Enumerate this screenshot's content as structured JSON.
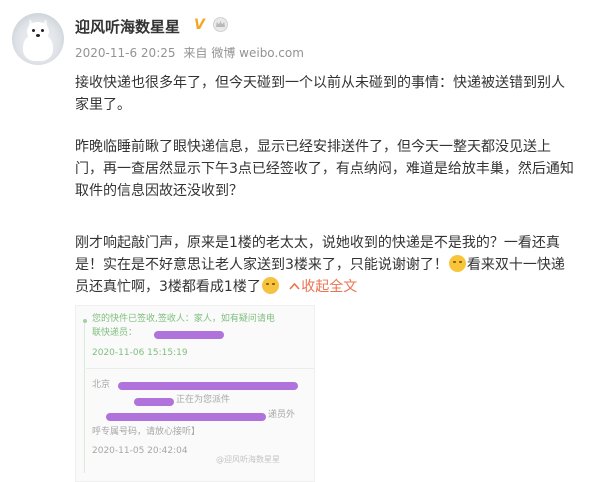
{
  "user": {
    "name": "迎风听海数星星",
    "vip_mark": "V"
  },
  "meta": {
    "datetime": "2020-11-6 20:25",
    "source_prefix": "来自",
    "source": "微博 weibo.com"
  },
  "post": {
    "p1": "接收快递也很多年了，但今天碰到一个以前从未碰到的事情：快递被送错到别人家里了。",
    "p2": "昨晚临睡前瞅了眼快递信息，显示已经安排送件了，但今天一整天都没见送上门，再一查居然显示下午3点已经签收了，有点纳闷，难道是给放丰巢，然后通知取件的信息因故还没收到？",
    "p3_a": "刚才响起敲门声，原来是1楼的老太太，说她收到的快递是不是我的？一看还真是！实在是不好意思让老人家送到3楼来了，只能说谢谢了！",
    "p3_b": "看来双十一快递员还真忙啊，3楼都看成1楼了",
    "collapse": "收起全文",
    "emoji1": "sweat-smile-emoji",
    "emoji2": "laugh-emoji"
  },
  "photo": {
    "entry1_line1": "您的快件已签收,签收人：家人，如有疑问请电",
    "entry1_line2": "联快递员：",
    "entry1_time": "2020-11-06 15:15:19",
    "entry2_line1": "北京",
    "entry2_line2": "正在为您派件",
    "entry2_line3": "递员外",
    "entry2_line4": "呼专属号码，请放心接听】",
    "entry2_time": "2020-11-05 20:42:04",
    "watermark": "@迎风听海数星星",
    "colors": {
      "timeline": "#9fd39f",
      "redaction": "#a764d8"
    }
  },
  "colors": {
    "link": "#eb7350",
    "meta": "#939393",
    "text": "#333333",
    "vip": "#f6a623"
  }
}
